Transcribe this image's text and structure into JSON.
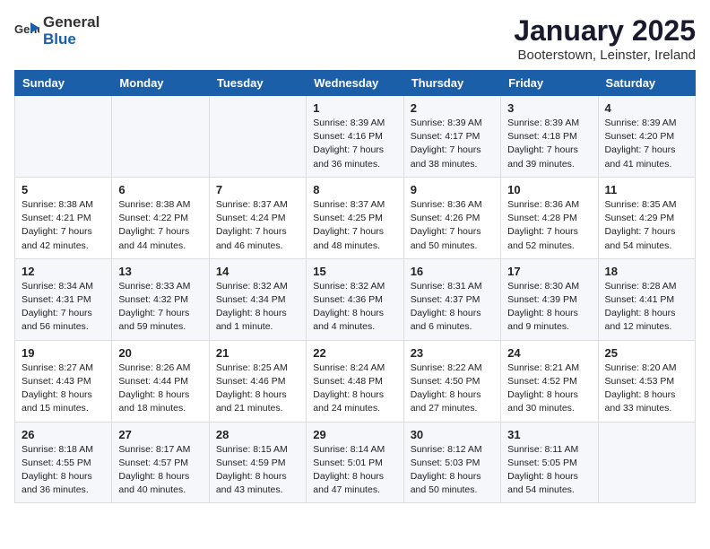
{
  "logo": {
    "text_general": "General",
    "text_blue": "Blue"
  },
  "title": "January 2025",
  "subtitle": "Booterstown, Leinster, Ireland",
  "days_of_week": [
    "Sunday",
    "Monday",
    "Tuesday",
    "Wednesday",
    "Thursday",
    "Friday",
    "Saturday"
  ],
  "weeks": [
    [
      {
        "day": "",
        "content": ""
      },
      {
        "day": "",
        "content": ""
      },
      {
        "day": "",
        "content": ""
      },
      {
        "day": "1",
        "content": "Sunrise: 8:39 AM\nSunset: 4:16 PM\nDaylight: 7 hours\nand 36 minutes."
      },
      {
        "day": "2",
        "content": "Sunrise: 8:39 AM\nSunset: 4:17 PM\nDaylight: 7 hours\nand 38 minutes."
      },
      {
        "day": "3",
        "content": "Sunrise: 8:39 AM\nSunset: 4:18 PM\nDaylight: 7 hours\nand 39 minutes."
      },
      {
        "day": "4",
        "content": "Sunrise: 8:39 AM\nSunset: 4:20 PM\nDaylight: 7 hours\nand 41 minutes."
      }
    ],
    [
      {
        "day": "5",
        "content": "Sunrise: 8:38 AM\nSunset: 4:21 PM\nDaylight: 7 hours\nand 42 minutes."
      },
      {
        "day": "6",
        "content": "Sunrise: 8:38 AM\nSunset: 4:22 PM\nDaylight: 7 hours\nand 44 minutes."
      },
      {
        "day": "7",
        "content": "Sunrise: 8:37 AM\nSunset: 4:24 PM\nDaylight: 7 hours\nand 46 minutes."
      },
      {
        "day": "8",
        "content": "Sunrise: 8:37 AM\nSunset: 4:25 PM\nDaylight: 7 hours\nand 48 minutes."
      },
      {
        "day": "9",
        "content": "Sunrise: 8:36 AM\nSunset: 4:26 PM\nDaylight: 7 hours\nand 50 minutes."
      },
      {
        "day": "10",
        "content": "Sunrise: 8:36 AM\nSunset: 4:28 PM\nDaylight: 7 hours\nand 52 minutes."
      },
      {
        "day": "11",
        "content": "Sunrise: 8:35 AM\nSunset: 4:29 PM\nDaylight: 7 hours\nand 54 minutes."
      }
    ],
    [
      {
        "day": "12",
        "content": "Sunrise: 8:34 AM\nSunset: 4:31 PM\nDaylight: 7 hours\nand 56 minutes."
      },
      {
        "day": "13",
        "content": "Sunrise: 8:33 AM\nSunset: 4:32 PM\nDaylight: 7 hours\nand 59 minutes."
      },
      {
        "day": "14",
        "content": "Sunrise: 8:32 AM\nSunset: 4:34 PM\nDaylight: 8 hours\nand 1 minute."
      },
      {
        "day": "15",
        "content": "Sunrise: 8:32 AM\nSunset: 4:36 PM\nDaylight: 8 hours\nand 4 minutes."
      },
      {
        "day": "16",
        "content": "Sunrise: 8:31 AM\nSunset: 4:37 PM\nDaylight: 8 hours\nand 6 minutes."
      },
      {
        "day": "17",
        "content": "Sunrise: 8:30 AM\nSunset: 4:39 PM\nDaylight: 8 hours\nand 9 minutes."
      },
      {
        "day": "18",
        "content": "Sunrise: 8:28 AM\nSunset: 4:41 PM\nDaylight: 8 hours\nand 12 minutes."
      }
    ],
    [
      {
        "day": "19",
        "content": "Sunrise: 8:27 AM\nSunset: 4:43 PM\nDaylight: 8 hours\nand 15 minutes."
      },
      {
        "day": "20",
        "content": "Sunrise: 8:26 AM\nSunset: 4:44 PM\nDaylight: 8 hours\nand 18 minutes."
      },
      {
        "day": "21",
        "content": "Sunrise: 8:25 AM\nSunset: 4:46 PM\nDaylight: 8 hours\nand 21 minutes."
      },
      {
        "day": "22",
        "content": "Sunrise: 8:24 AM\nSunset: 4:48 PM\nDaylight: 8 hours\nand 24 minutes."
      },
      {
        "day": "23",
        "content": "Sunrise: 8:22 AM\nSunset: 4:50 PM\nDaylight: 8 hours\nand 27 minutes."
      },
      {
        "day": "24",
        "content": "Sunrise: 8:21 AM\nSunset: 4:52 PM\nDaylight: 8 hours\nand 30 minutes."
      },
      {
        "day": "25",
        "content": "Sunrise: 8:20 AM\nSunset: 4:53 PM\nDaylight: 8 hours\nand 33 minutes."
      }
    ],
    [
      {
        "day": "26",
        "content": "Sunrise: 8:18 AM\nSunset: 4:55 PM\nDaylight: 8 hours\nand 36 minutes."
      },
      {
        "day": "27",
        "content": "Sunrise: 8:17 AM\nSunset: 4:57 PM\nDaylight: 8 hours\nand 40 minutes."
      },
      {
        "day": "28",
        "content": "Sunrise: 8:15 AM\nSunset: 4:59 PM\nDaylight: 8 hours\nand 43 minutes."
      },
      {
        "day": "29",
        "content": "Sunrise: 8:14 AM\nSunset: 5:01 PM\nDaylight: 8 hours\nand 47 minutes."
      },
      {
        "day": "30",
        "content": "Sunrise: 8:12 AM\nSunset: 5:03 PM\nDaylight: 8 hours\nand 50 minutes."
      },
      {
        "day": "31",
        "content": "Sunrise: 8:11 AM\nSunset: 5:05 PM\nDaylight: 8 hours\nand 54 minutes."
      },
      {
        "day": "",
        "content": ""
      }
    ]
  ]
}
